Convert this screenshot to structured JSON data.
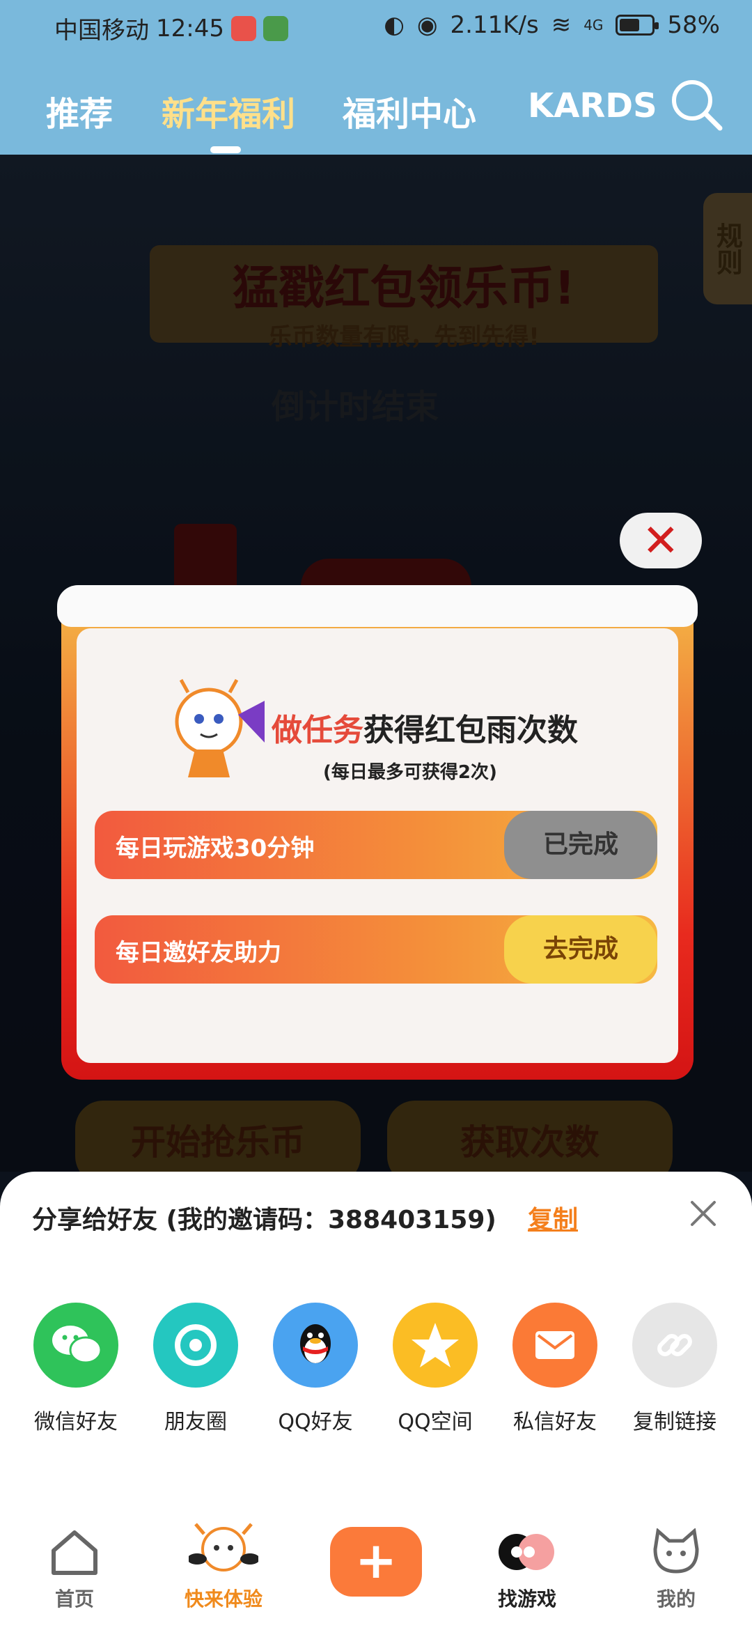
{
  "status_bar": {
    "carrier": "中国移动",
    "time": "12:45",
    "network_speed": "2.11K/s",
    "signal": "4G",
    "battery": "58%",
    "battery_level": 0.58
  },
  "header": {
    "tabs": [
      {
        "label": "推荐",
        "active": false
      },
      {
        "label": "新年福利",
        "active": true
      },
      {
        "label": "福利中心",
        "active": false
      },
      {
        "label": "KARDS",
        "active": false
      }
    ],
    "search_icon": "search-icon"
  },
  "background": {
    "rules_tab": "规则",
    "banner_title": "猛戳红包领乐币!",
    "banner_subtitle": "乐币数量有限，先到先得!",
    "countdown": "倒计时结束",
    "start_button": "开始抢乐币",
    "get_times_button": "获取次数"
  },
  "dialog": {
    "title_highlight": "做任务",
    "title_rest": "获得红包雨次数",
    "subtitle": "(每日最多可获得2次)",
    "tasks": [
      {
        "label": "每日玩游戏30分钟",
        "button": "已完成",
        "state": "done"
      },
      {
        "label": "每日邀好友助力",
        "button": "去完成",
        "state": "todo"
      }
    ]
  },
  "share_sheet": {
    "title": "分享给好友 (我的邀请码：388403159)",
    "copy_label": "复制",
    "options": [
      {
        "label": "微信好友",
        "icon": "wechat-icon",
        "color": "#2fc35a"
      },
      {
        "label": "朋友圈",
        "icon": "moments-icon",
        "color": "#24c7c0"
      },
      {
        "label": "QQ好友",
        "icon": "qq-icon",
        "color": "#4aa3f0"
      },
      {
        "label": "QQ空间",
        "icon": "qzone-icon",
        "color": "#fbbd24"
      },
      {
        "label": "私信好友",
        "icon": "mail-icon",
        "color": "#fb7a36"
      },
      {
        "label": "复制链接",
        "icon": "link-icon",
        "color": "#e6e6e6"
      }
    ]
  },
  "bottom_nav": {
    "items": [
      {
        "label": "首页",
        "icon": "home-icon"
      },
      {
        "label": "快来体验",
        "icon": "mascot-icon"
      },
      {
        "label": "",
        "icon": "plus-icon"
      },
      {
        "label": "找游戏",
        "icon": "find-games-icon"
      },
      {
        "label": "我的",
        "icon": "profile-icon"
      }
    ]
  }
}
